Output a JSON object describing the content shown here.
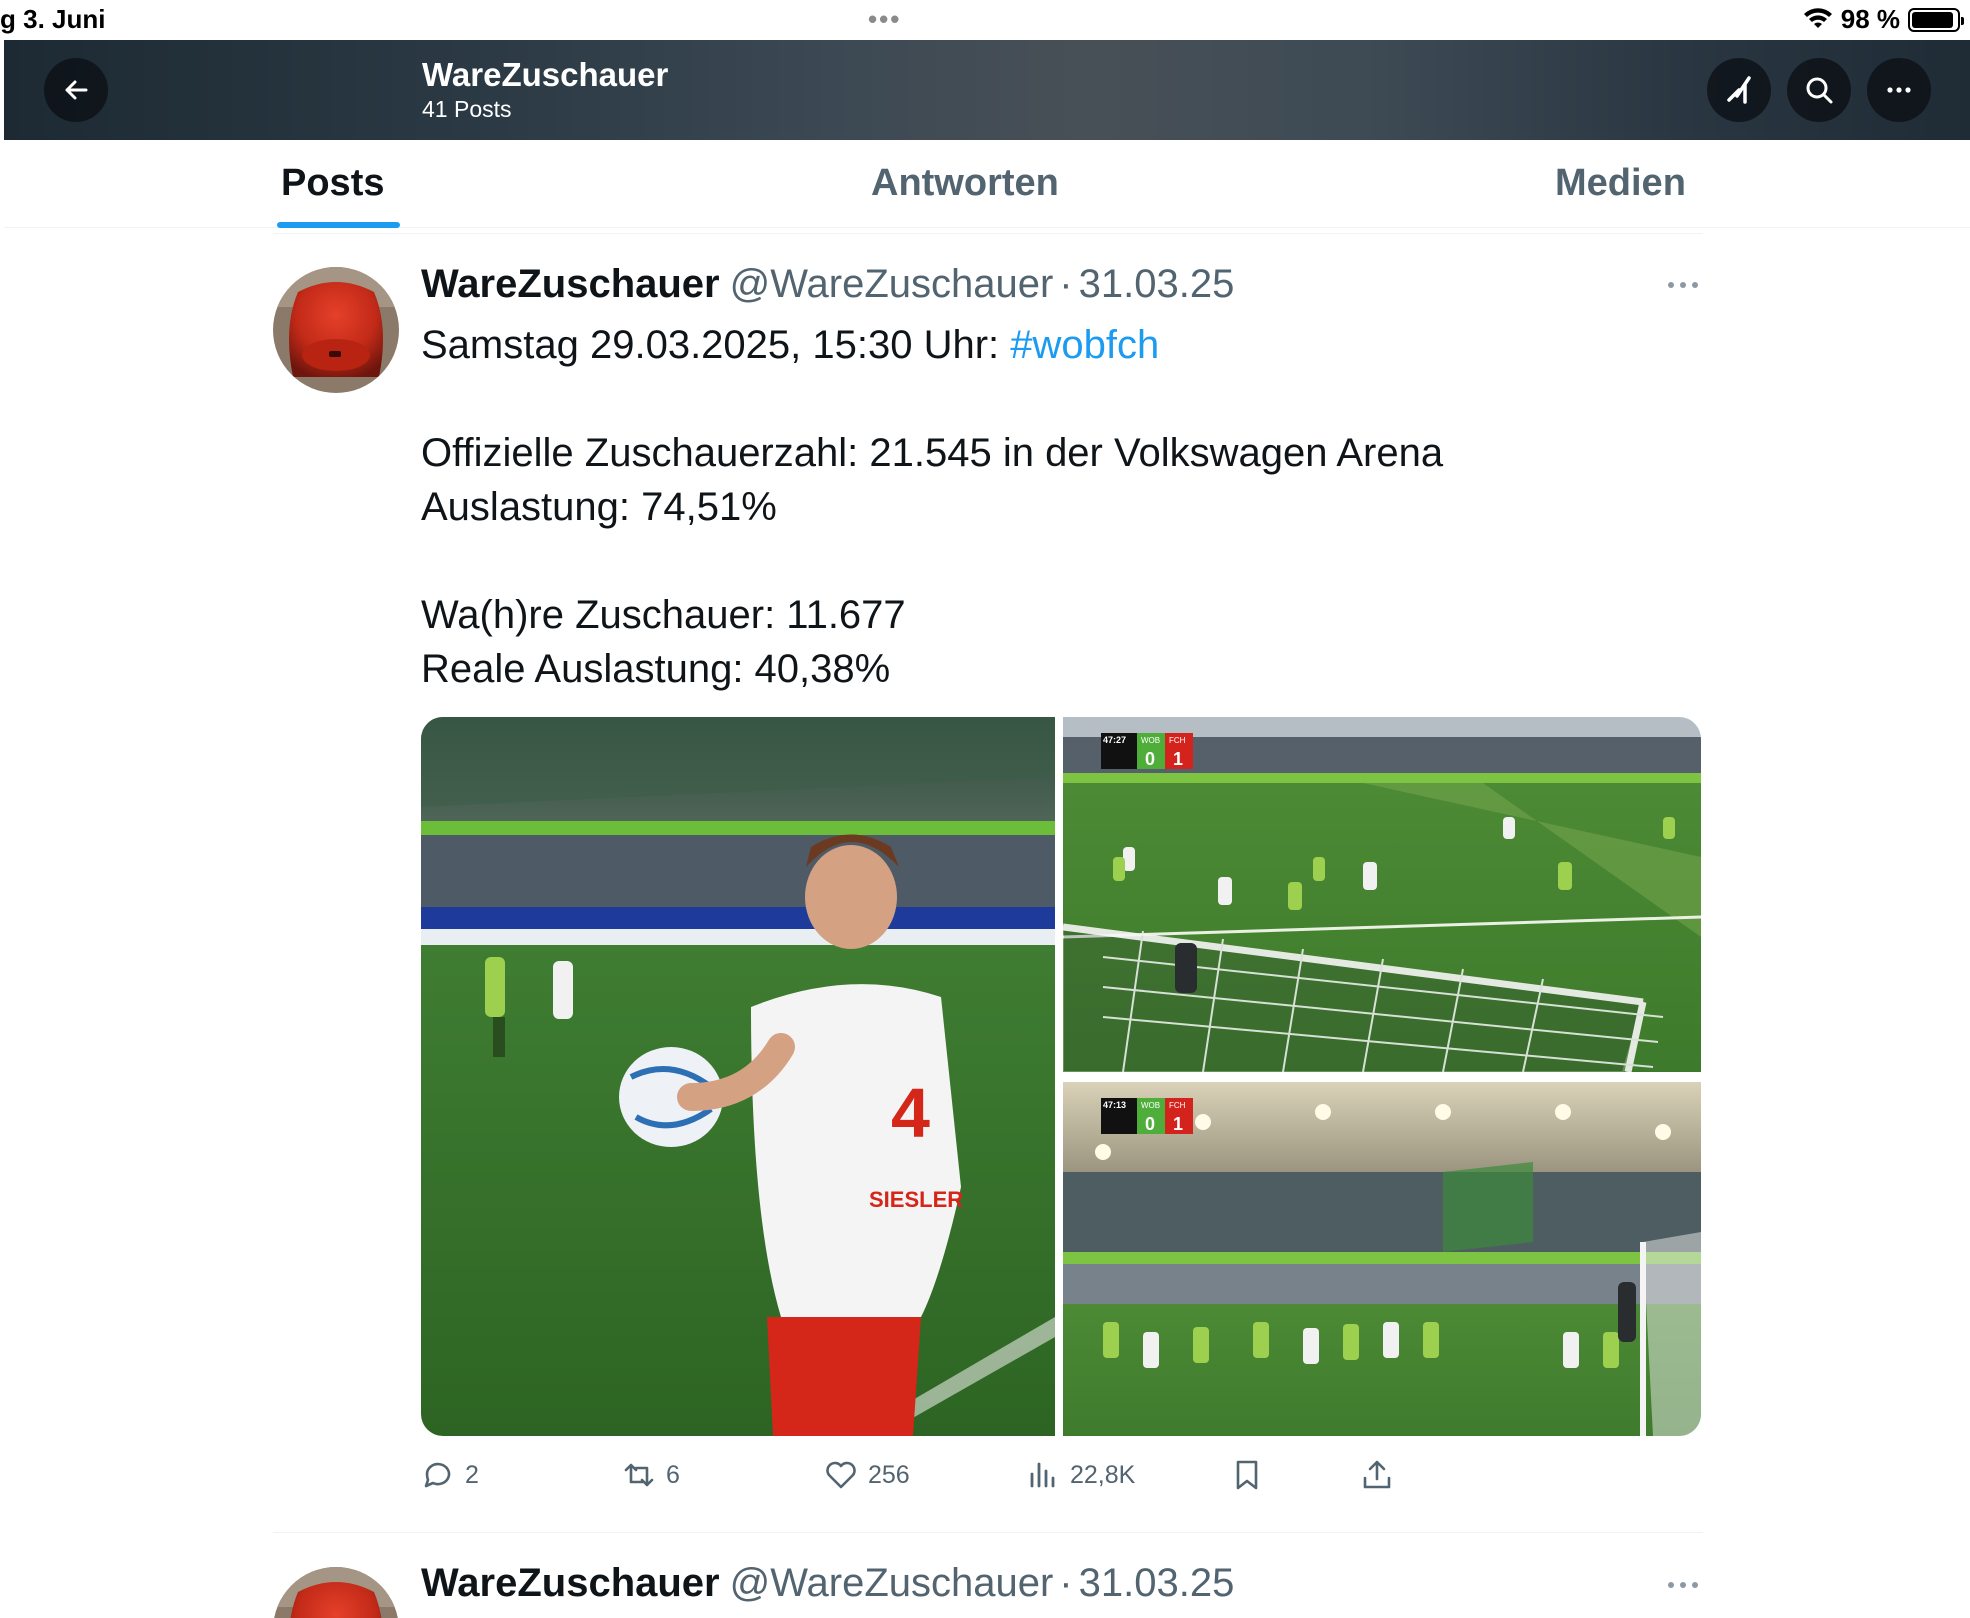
{
  "status_bar": {
    "date": "g 3. Juni",
    "battery": "98 %",
    "battery_level": 0.98
  },
  "header": {
    "title": "WareZuschauer",
    "subtitle": "41 Posts"
  },
  "tabs": [
    {
      "label": "Posts",
      "active": true
    },
    {
      "label": "Antworten",
      "active": false
    },
    {
      "label": "Medien",
      "active": false
    }
  ],
  "tweet": {
    "name": "WareZuschauer",
    "handle": "@WareZuschauer",
    "separator": "·",
    "date": "31.03.25",
    "line1_text": "Samstag 29.03.2025, 15:30 Uhr: ",
    "hashtag": "#wobfch",
    "line2": "Offizielle Zuschauerzahl: 21.545 in der Volkswagen Arena",
    "line3": "Auslastung: 74,51%",
    "line4": "Wa(h)re Zuschauer: 11.677",
    "line5": "Reale Auslastung: 40,38%",
    "media": {
      "jersey_text": "SIESLER",
      "jersey_number": "4",
      "scoreboard_top": {
        "clock": "47:27",
        "home": "WOB",
        "away": "FCH",
        "home_score": "0",
        "away_score": "1"
      },
      "scoreboard_bottom": {
        "clock": "47:13",
        "home": "WOB",
        "away": "FCH",
        "home_score": "0",
        "away_score": "1"
      }
    },
    "replies": "2",
    "reposts": "6",
    "likes": "256",
    "views": "22,8K"
  },
  "tweet2": {
    "name": "WareZuschauer",
    "handle": "@WareZuschauer",
    "separator": "·",
    "date": "31.03.25"
  },
  "colors": {
    "accent": "#1d9bf0",
    "secondary_text": "#536471",
    "primary_text": "#0f1419"
  }
}
